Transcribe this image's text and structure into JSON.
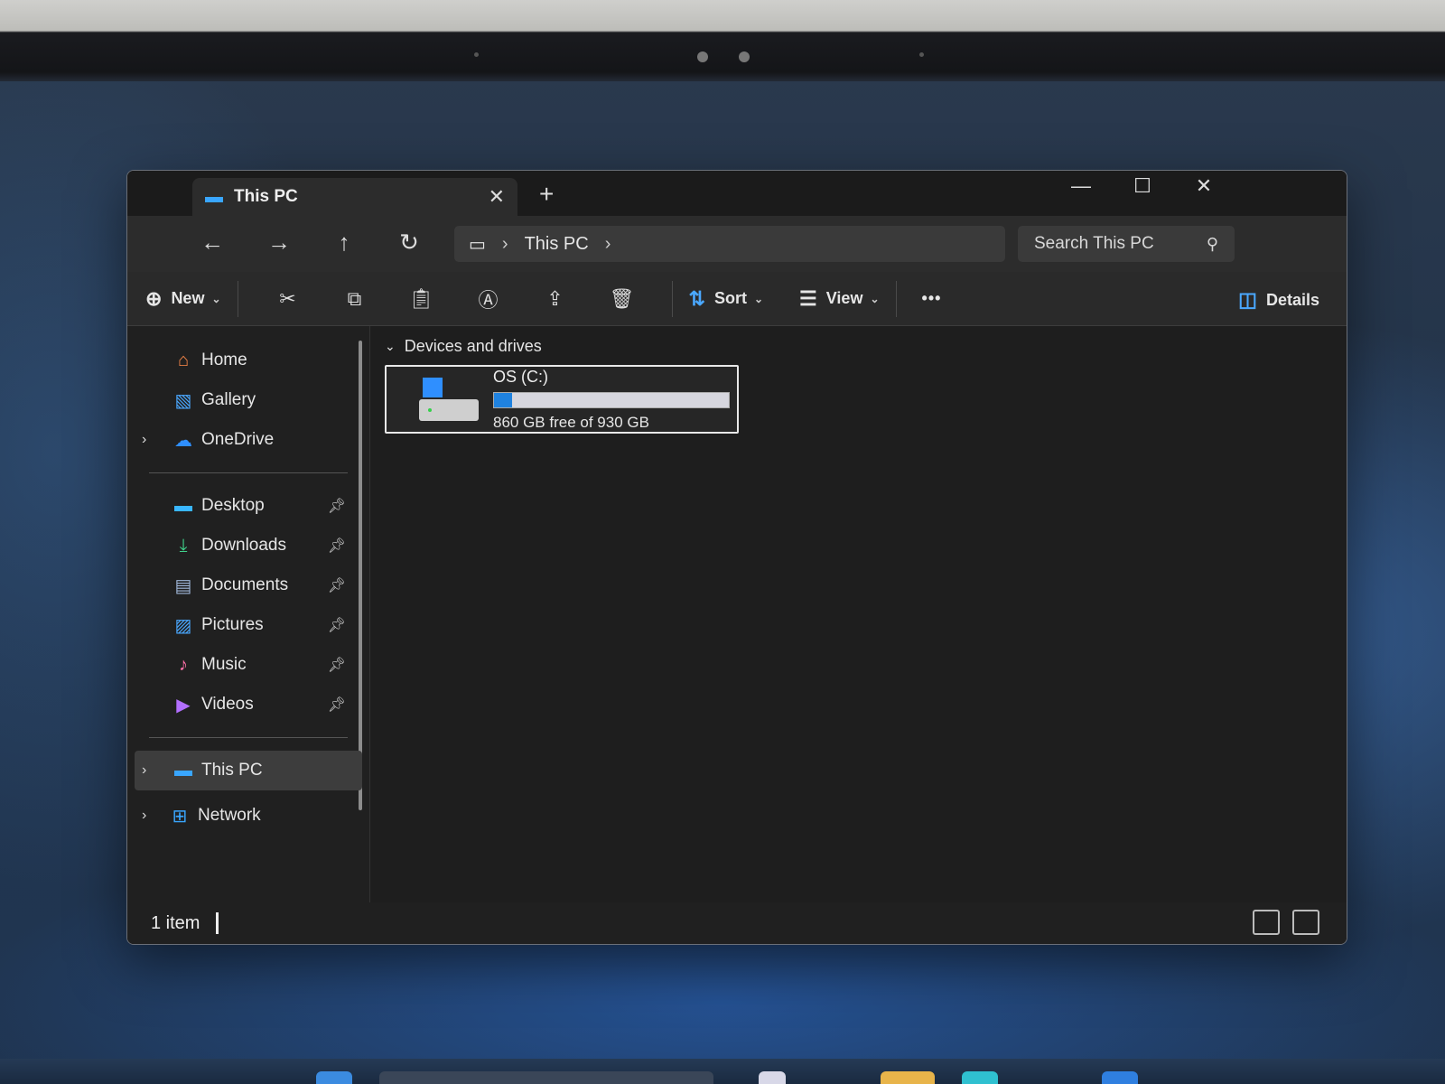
{
  "window": {
    "tab_title": "This PC",
    "new_tab_symbol": "+",
    "close_symbol": "✕",
    "minimize_symbol": "—",
    "maximize_symbol": "☐"
  },
  "address_bar": {
    "location": "This PC",
    "search_placeholder": "Search This PC"
  },
  "toolbar": {
    "new_label": "New",
    "sort_label": "Sort",
    "view_label": "View",
    "more_label": "•••",
    "details_label": "Details",
    "icons": [
      "cut-icon",
      "copy-icon",
      "paste-icon",
      "rename-icon",
      "share-icon",
      "delete-icon"
    ]
  },
  "sidebar": {
    "top_items": [
      {
        "label": "Home",
        "icon": "home-icon"
      },
      {
        "label": "Gallery",
        "icon": "gallery-icon"
      },
      {
        "label": "OneDrive",
        "icon": "onedrive-icon"
      }
    ],
    "pinned_items": [
      {
        "label": "Desktop",
        "icon": "desktop-icon"
      },
      {
        "label": "Downloads",
        "icon": "downloads-icon"
      },
      {
        "label": "Documents",
        "icon": "documents-icon"
      },
      {
        "label": "Pictures",
        "icon": "pictures-icon"
      },
      {
        "label": "Music",
        "icon": "music-icon"
      },
      {
        "label": "Videos",
        "icon": "videos-icon"
      }
    ],
    "bottom_items": [
      {
        "label": "This PC",
        "icon": "this-pc-icon",
        "selected": true
      },
      {
        "label": "Network",
        "icon": "network-icon"
      }
    ]
  },
  "content": {
    "group_header": "Devices and drives",
    "drives": [
      {
        "name": "OS (C:)",
        "free_text": "860 GB free of 930 GB",
        "used_fraction": 0.075
      }
    ]
  },
  "status": {
    "item_count": "1 item"
  },
  "colors": {
    "accent": "#1f82e0",
    "window_bg": "#202020",
    "toolbar_bg": "#2a2a2a"
  }
}
